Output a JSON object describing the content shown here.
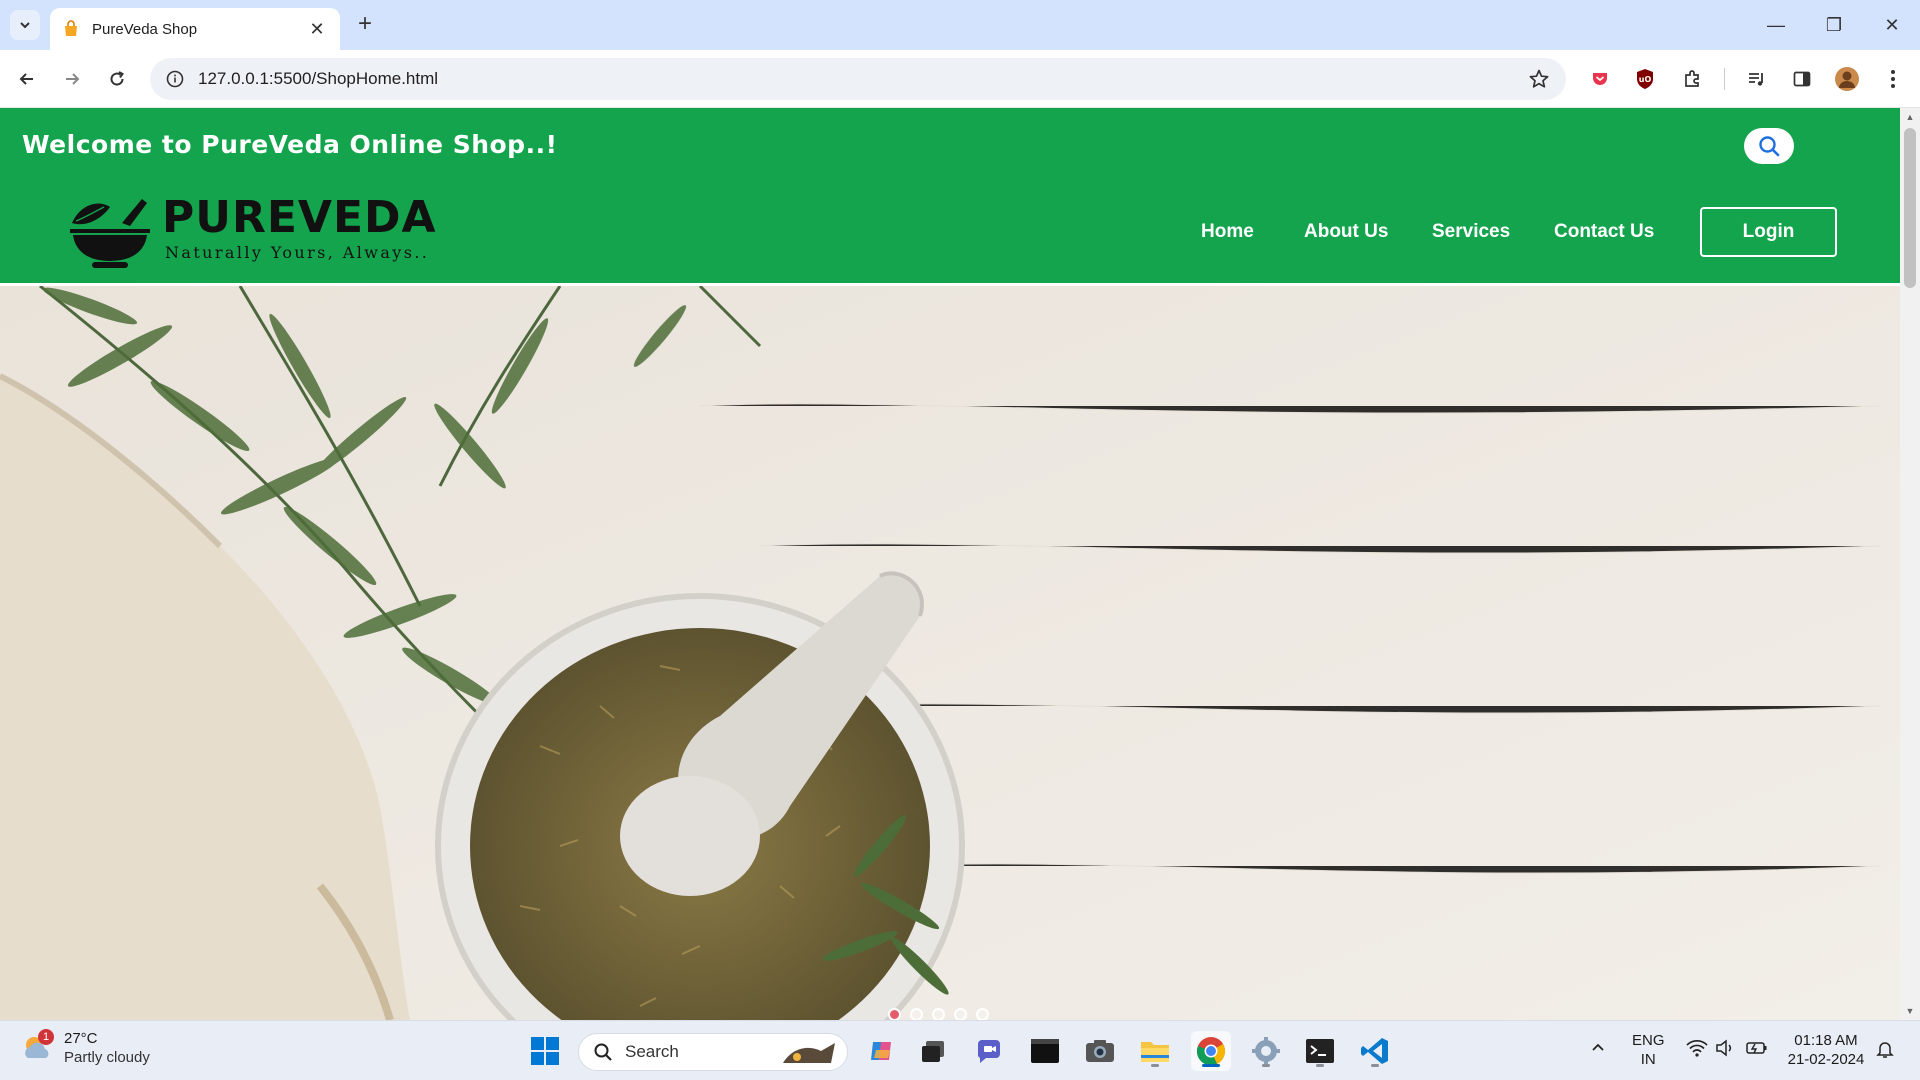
{
  "browser": {
    "tab_title": "PureVeda Shop",
    "tab_close": "✕",
    "new_tab": "+",
    "url": "127.0.0.1:5500/ShopHome.html",
    "window_minimize": "—",
    "window_restore": "❐",
    "window_close": "✕"
  },
  "site": {
    "welcome_text": "Welcome to PureVeda Online Shop..!",
    "brand_name": "PUREVEDA",
    "brand_tagline": "Naturally Yours, Always..",
    "nav": {
      "home": "Home",
      "about": "About Us",
      "services": "Services",
      "contact": "Contact Us",
      "login": "Login"
    },
    "carousel": {
      "slide_count": 5,
      "active_index": 0
    },
    "colors": {
      "header_green": "#14a44d",
      "active_dot": "#e35d6a"
    }
  },
  "taskbar": {
    "weather_badge": "1",
    "weather_temp": "27°C",
    "weather_condition": "Partly cloudy",
    "search_label": "Search",
    "lang_line1": "ENG",
    "lang_line2": "IN",
    "time": "01:18 AM",
    "date": "21-02-2024"
  }
}
